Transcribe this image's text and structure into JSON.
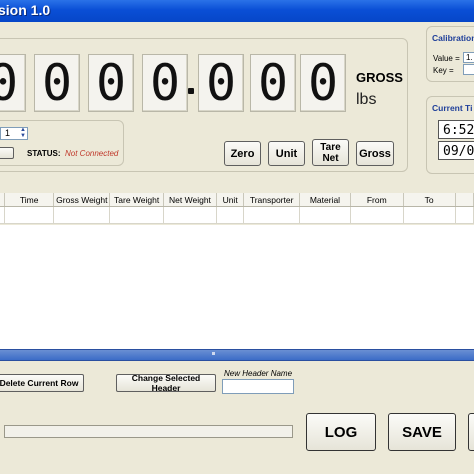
{
  "window": {
    "title": "sion 1.0"
  },
  "display": {
    "digits": [
      "0",
      "0",
      "0",
      "0",
      "0",
      "0",
      "0",
      "0"
    ],
    "mode": "GROSS",
    "unit": "lbs"
  },
  "calibration": {
    "title": "Calibration",
    "value_label": "Value =",
    "value": "1.",
    "key_label": "Key ="
  },
  "current_time": {
    "title": "Current Ti",
    "time": "6:52",
    "date": "09/0"
  },
  "connection": {
    "port_value": "1",
    "status_label": "STATUS:",
    "status_value": "Not Connected"
  },
  "buttons": {
    "zero": "Zero",
    "unit": "Unit",
    "tare_net_line1": "Tare",
    "tare_net_line2": "Net",
    "gross": "Gross",
    "delete_row": "Delete Current Row",
    "change_header": "Change Selected Header",
    "log": "LOG",
    "save": "SAVE"
  },
  "table": {
    "columns": [
      "Time",
      "Gross Weight",
      "Tare Weight",
      "Net Weight",
      "Unit",
      "Transporter",
      "Material",
      "From",
      "To"
    ]
  },
  "header_edit": {
    "label": "New Header Name",
    "value": ""
  },
  "colors": {
    "status": "#c0392b",
    "panel_title": "#1f3f9a",
    "titlebar": "#0a4fd6"
  }
}
